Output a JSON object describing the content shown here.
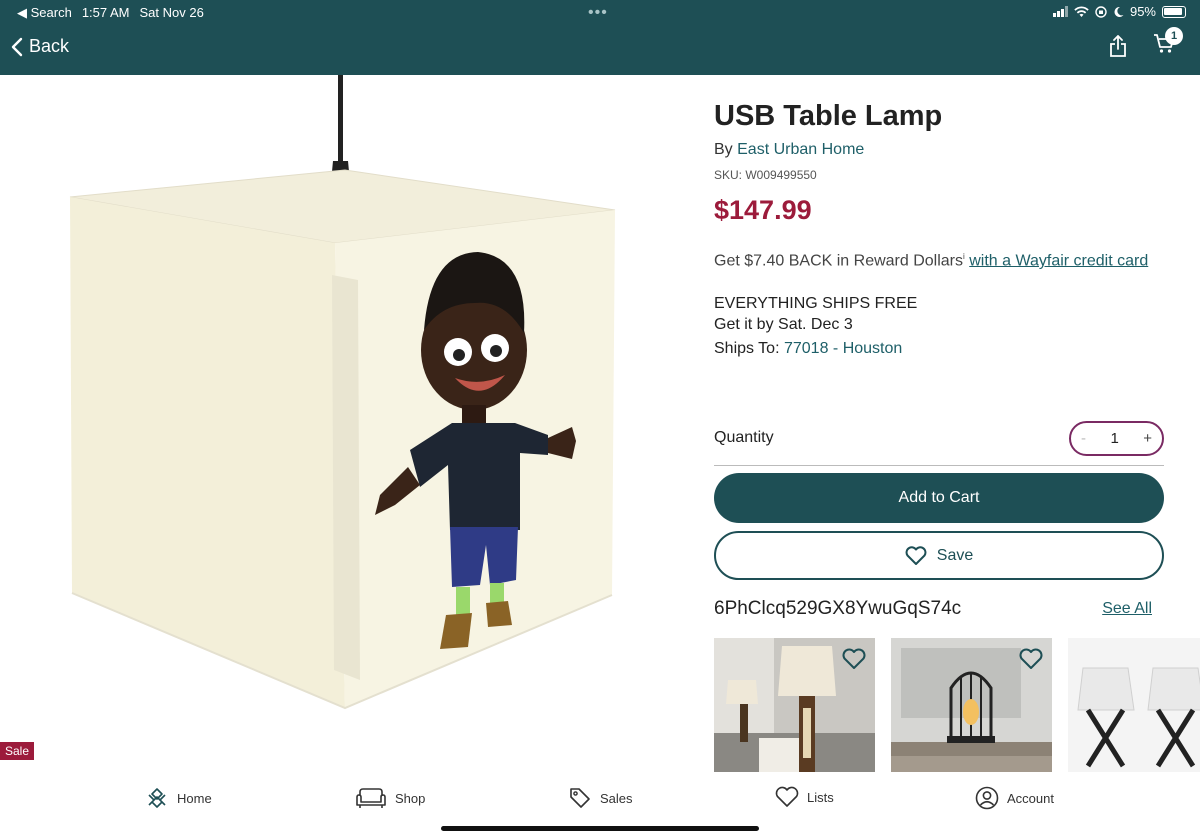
{
  "status_bar": {
    "back_app": "◀ Search",
    "time": "1:57 AM",
    "date": "Sat Nov 26",
    "battery": "95%"
  },
  "nav": {
    "back_label": "Back",
    "cart_count": "1"
  },
  "product": {
    "title": "USB Table Lamp",
    "by_prefix": "By",
    "brand": "East Urban Home",
    "sku": "SKU: W009499550",
    "price": "$147.99",
    "reward_text": "Get $7.40 BACK in Reward Dollars",
    "reward_mark": "i",
    "reward_link": "with a Wayfair credit card",
    "shipping_line1": "EVERYTHING SHIPS FREE",
    "shipping_line2": "Get it by Sat. Dec 3",
    "ships_to_label": "Ships To:",
    "ships_to_value": "77018 - Houston",
    "sale_badge": "Sale"
  },
  "quantity": {
    "label": "Quantity",
    "value": "1",
    "minus": "-",
    "plus": "+"
  },
  "buttons": {
    "add_to_cart": "Add to Cart",
    "save": "Save"
  },
  "similar": {
    "title": "6PhClcq529GX8YwuGqS74c",
    "see_all": "See All"
  },
  "tabs": [
    {
      "label": "Home",
      "icon": "home-icon"
    },
    {
      "label": "Shop",
      "icon": "sofa-icon"
    },
    {
      "label": "Sales",
      "icon": "tag-icon"
    },
    {
      "label": "Lists",
      "icon": "heart-icon"
    },
    {
      "label": "Account",
      "icon": "account-icon"
    }
  ],
  "colors": {
    "brand_teal": "#1e4f55",
    "price_red": "#9c1b3b",
    "stepper_border": "#7a2a63"
  }
}
